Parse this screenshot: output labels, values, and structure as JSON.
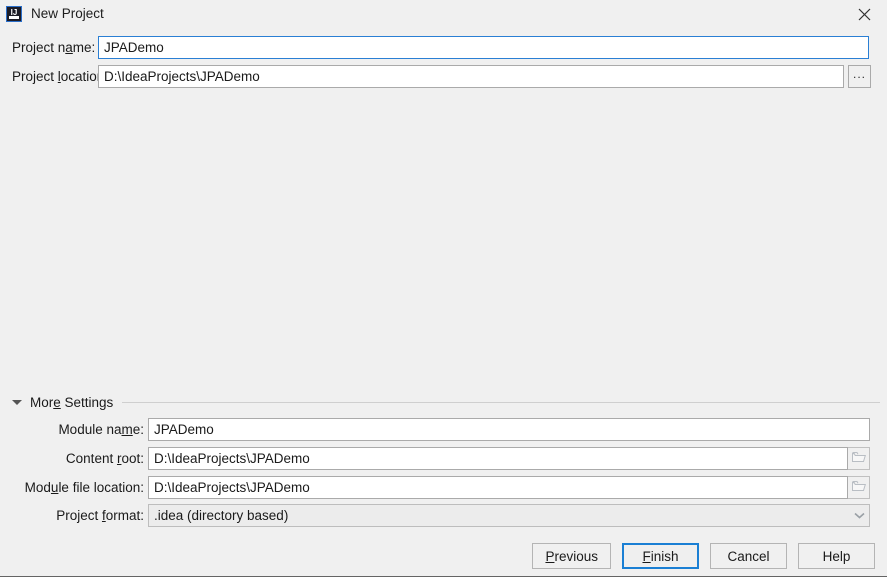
{
  "window": {
    "title": "New Project",
    "app_icon": "intellij-idea-icon",
    "icon_text": "IJ",
    "close_label": "close-icon"
  },
  "top_fields": [
    {
      "id": "project-name",
      "label_before": "Project n",
      "label_accel": "a",
      "label_after": "me:",
      "value": "JPADemo",
      "placeholder": "",
      "focused": true,
      "has_browse": false
    },
    {
      "id": "project-location",
      "label_before": "Project ",
      "label_accel": "l",
      "label_after": "ocation:",
      "value": "D:\\IdeaProjects\\JPADemo",
      "placeholder": "",
      "focused": false,
      "has_browse": true,
      "browse_label": "..."
    }
  ],
  "more_settings": {
    "label_before": "Mor",
    "label_accel": "e",
    "label_after": " Settings",
    "expanded": true,
    "toggle_icon": "triangle-down-icon"
  },
  "settings_fields": [
    {
      "id": "module-name",
      "label_before": "Module na",
      "label_accel": "m",
      "label_after": "e:",
      "value": "JPADemo",
      "type": "text",
      "has_folder": false
    },
    {
      "id": "content-root",
      "label_before": "Content ",
      "label_accel": "r",
      "label_after": "oot:",
      "value": "D:\\IdeaProjects\\JPADemo",
      "type": "text",
      "has_folder": true,
      "folder_icon": "folder-icon"
    },
    {
      "id": "module-file-location",
      "label_before": "Mod",
      "label_accel": "u",
      "label_after": "le file location:",
      "value": "D:\\IdeaProjects\\JPADemo",
      "type": "text",
      "has_folder": true,
      "folder_icon": "folder-icon"
    },
    {
      "id": "project-format",
      "label_before": "Project ",
      "label_accel": "f",
      "label_after": "ormat:",
      "value": ".idea (directory based)",
      "type": "combo",
      "arrow_icon": "chevron-down-icon",
      "options": [
        ".idea (directory based)"
      ]
    }
  ],
  "buttons": [
    {
      "id": "previous",
      "before": "",
      "accel": "P",
      "after": "revious",
      "default": false
    },
    {
      "id": "finish",
      "before": "",
      "accel": "F",
      "after": "inish",
      "default": true
    },
    {
      "id": "cancel",
      "before": "Cancel",
      "accel": "",
      "after": "",
      "default": false
    },
    {
      "id": "help",
      "before": "Help",
      "accel": "",
      "after": "",
      "default": false
    }
  ],
  "colors": {
    "background": "#f0f0f0",
    "accent_blue": "#1a7fd4",
    "focus_border": "#2a7fd4",
    "field_background": "#ffffff",
    "combo_background": "#ececec",
    "border_gray": "#aaaaaa",
    "text": "#1a1a1a"
  }
}
